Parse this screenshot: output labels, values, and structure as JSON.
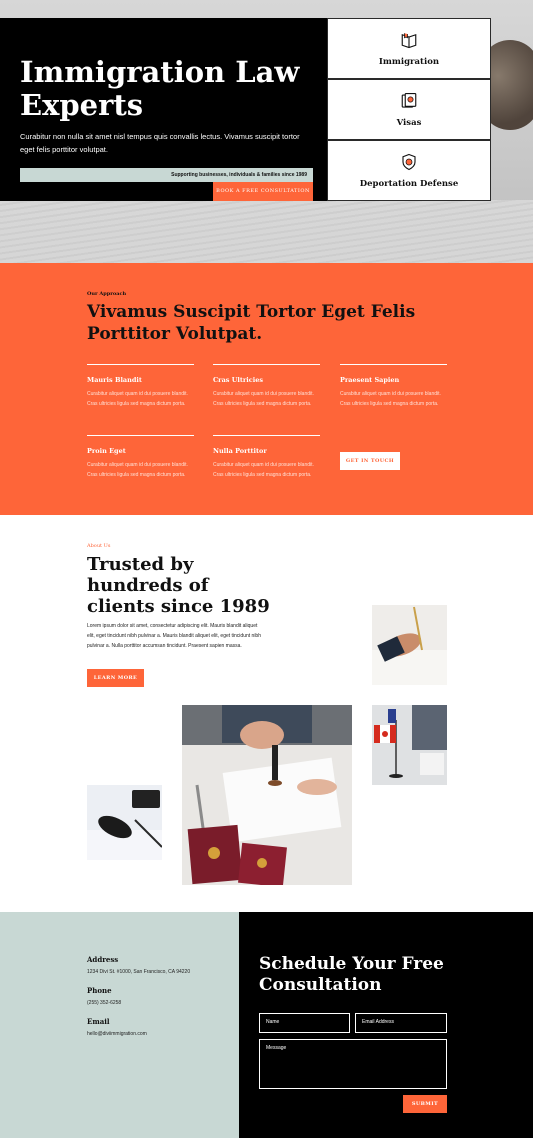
{
  "hero": {
    "title": "Immigration Law Experts",
    "subtitle": "Curabitur non nulla sit amet nisl tempus quis convallis lectus. Vivamus suscipit tortor eget felis porttitor volutpat.",
    "strip_text": "Supporting businesses, individuals & families since 1989",
    "cta_label": "BOOK A FREE CONSULTATION",
    "services": [
      {
        "label": "Immigration",
        "icon": "book-icon"
      },
      {
        "label": "Visas",
        "icon": "passport-icon"
      },
      {
        "label": "Deportation Defense",
        "icon": "shield-icon"
      }
    ]
  },
  "approach": {
    "kicker": "Our Approach",
    "title": "Vivamus Suscipit Tortor Eget Felis Porttitor Volutpat.",
    "features": [
      {
        "title": "Mauris Blandit",
        "text": "Curabitur aliquet quam id dui posuere blandit. Cras ultricies ligula sed magna dictum porta."
      },
      {
        "title": "Cras Ultricies",
        "text": "Curabitur aliquet quam id dui posuere blandit. Cras ultricies ligula sed magna dictum porta."
      },
      {
        "title": "Praesent Sapien",
        "text": "Curabitur aliquet quam id dui posuere blandit. Cras ultricies ligula sed magna dictum porta."
      },
      {
        "title": "Proin Eget",
        "text": "Curabitur aliquet quam id dui posuere blandit. Cras ultricies ligula sed magna dictum porta."
      },
      {
        "title": "Nulla Porttitor",
        "text": "Curabitur aliquet quam id dui posuere blandit. Cras ultricies ligula sed magna dictum porta."
      }
    ],
    "cta_label": "GET IN TOUCH"
  },
  "about": {
    "kicker": "About Us",
    "title": "Trusted by hundreds of clients since 1989",
    "body": "Lorem ipsum dolor sit amet, consectetur adipiscing elit. Mauris blandit aliquet elit, eget tincidunt nibh pulvinar a. Mauris blandit aliquet elit, eget tincidunt nibh pulvinar a. Nulla porttitor accumsan tincidunt. Praesent sapien massa.",
    "cta_label": "LEARN MORE"
  },
  "contact": {
    "address_label": "Address",
    "address": "1234 Divi St. #1000, San Francisco, CA 94220",
    "phone_label": "Phone",
    "phone": "(255) 352-6258",
    "email_label": "Email",
    "email": "hello@diviimmigration.com",
    "form_title": "Schedule Your Free Consultation",
    "name_placeholder": "Name",
    "email_placeholder": "Email Address",
    "message_placeholder": "Message",
    "submit_label": "SUBMIT"
  },
  "colors": {
    "accent": "#fe6539",
    "mint": "#c8d8d4",
    "dark": "#000000"
  }
}
